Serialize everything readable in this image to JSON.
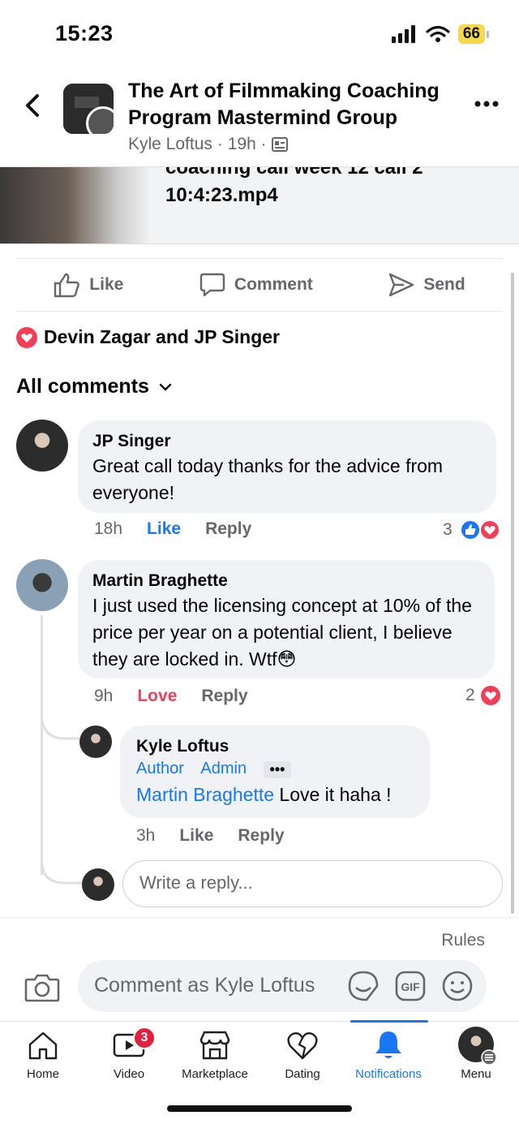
{
  "status_bar": {
    "time": "15:23",
    "battery": "66"
  },
  "header": {
    "title": "The Art of Filmmaking Coaching Program Mastermind Group",
    "author": "Kyle Loftus",
    "time": "· 19h ·"
  },
  "media": {
    "title_partial": "coaching call week 12 call 2",
    "filename": "10:4:23.mp4"
  },
  "actions": {
    "like": "Like",
    "comment": "Comment",
    "send": "Send"
  },
  "reactions": {
    "names": "Devin Zagar and JP Singer"
  },
  "comments_filter": "All comments",
  "comments": [
    {
      "name": "JP Singer",
      "text": "Great call today thanks for the advice from everyone!",
      "time": "18h",
      "reaction_action": "Like",
      "reply": "Reply",
      "count": "3"
    },
    {
      "name": "Martin Braghette",
      "text": "I just used the licensing concept at 10% of the price per year on a potential client, I believe they are locked in. Wtf😳",
      "time": "9h",
      "reaction_action": "Love",
      "reply": "Reply",
      "count": "2"
    }
  ],
  "reply": {
    "name": "Kyle Loftus",
    "badges": [
      "Author",
      "Admin"
    ],
    "more": "•••",
    "mention": "Martin Braghette",
    "text": " Love it haha !",
    "time": "3h",
    "like": "Like",
    "reply": "Reply"
  },
  "reply_input": {
    "placeholder": "Write a reply..."
  },
  "composer": {
    "rules": "Rules",
    "placeholder": "Comment as Kyle Loftus",
    "gif": "GIF"
  },
  "tabs": [
    {
      "label": "Home"
    },
    {
      "label": "Video",
      "badge": "3"
    },
    {
      "label": "Marketplace"
    },
    {
      "label": "Dating"
    },
    {
      "label": "Notifications",
      "active": true
    },
    {
      "label": "Menu"
    }
  ],
  "colors": {
    "accent": "#1877f2",
    "love": "#f33e58",
    "bubble": "#f0f2f5"
  }
}
